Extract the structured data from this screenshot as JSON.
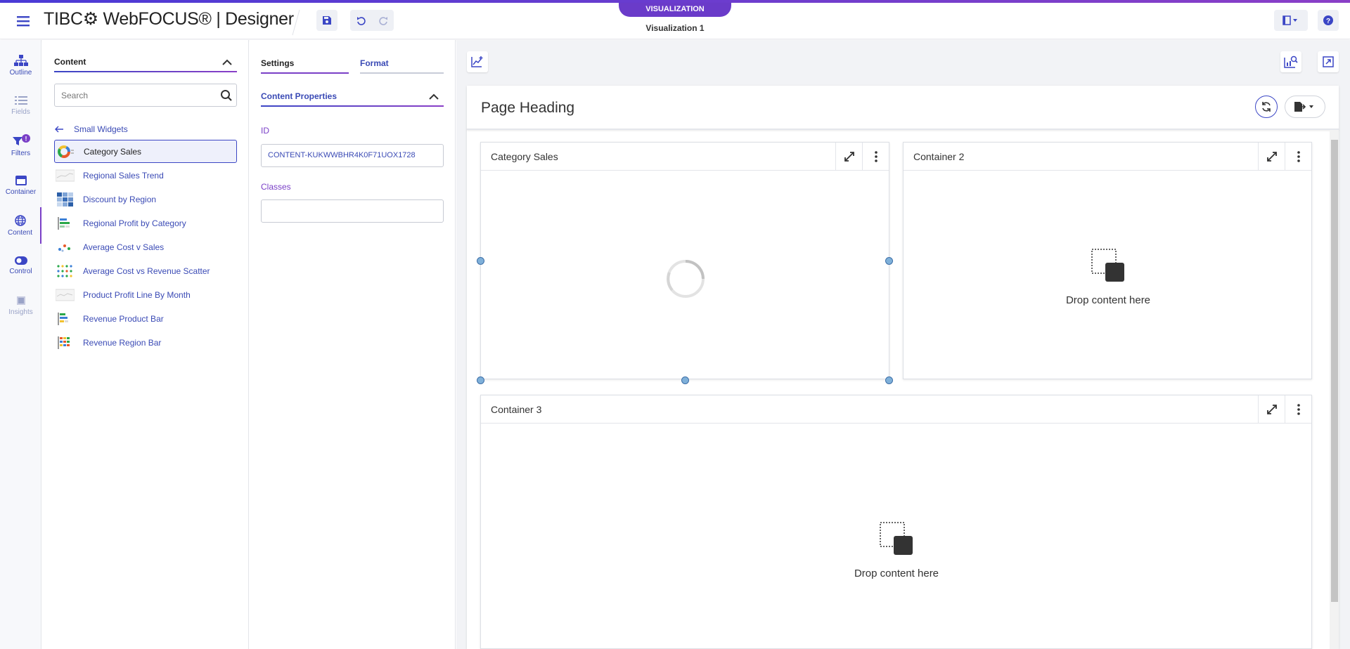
{
  "header": {
    "logo_text": "TIBC⚙ WebFOCUS® | Designer",
    "viz_badge": "VISUALIZATION",
    "viz_title": "Visualization 1"
  },
  "rail": {
    "items": [
      {
        "label": "Outline",
        "icon": "outline-icon"
      },
      {
        "label": "Fields",
        "icon": "fields-icon"
      },
      {
        "label": "Filters",
        "icon": "filters-icon",
        "badge": "!"
      },
      {
        "label": "Container",
        "icon": "container-icon"
      },
      {
        "label": "Content",
        "icon": "content-icon"
      },
      {
        "label": "Control",
        "icon": "control-icon"
      },
      {
        "label": "Insights",
        "icon": "insights-icon"
      }
    ]
  },
  "content_panel": {
    "title": "Content",
    "search_placeholder": "Search",
    "back_label": "Small Widgets",
    "widgets": [
      {
        "label": "Category Sales",
        "selected": true
      },
      {
        "label": "Regional Sales Trend"
      },
      {
        "label": "Discount by Region"
      },
      {
        "label": "Regional Profit by Category"
      },
      {
        "label": "Average Cost v Sales"
      },
      {
        "label": "Average Cost vs Revenue Scatter"
      },
      {
        "label": "Product Profit Line By Month"
      },
      {
        "label": "Revenue Product Bar"
      },
      {
        "label": "Revenue Region Bar"
      }
    ]
  },
  "properties_panel": {
    "tab_settings": "Settings",
    "tab_format": "Format",
    "section_title": "Content Properties",
    "id_label": "ID",
    "id_value": "CONTENT-KUKWWBHR4K0F71UOX1728",
    "classes_label": "Classes",
    "classes_value": ""
  },
  "canvas": {
    "page_heading": "Page Heading",
    "containers": [
      {
        "title": "Category Sales",
        "state": "loading"
      },
      {
        "title": "Container 2",
        "drop_text": "Drop content here"
      },
      {
        "title": "Container 3",
        "drop_text": "Drop content here"
      }
    ]
  },
  "colors": {
    "accent": "#3b46c5",
    "accent_purple": "#7a3fc7",
    "badge_purple": "#6a3bc9"
  }
}
